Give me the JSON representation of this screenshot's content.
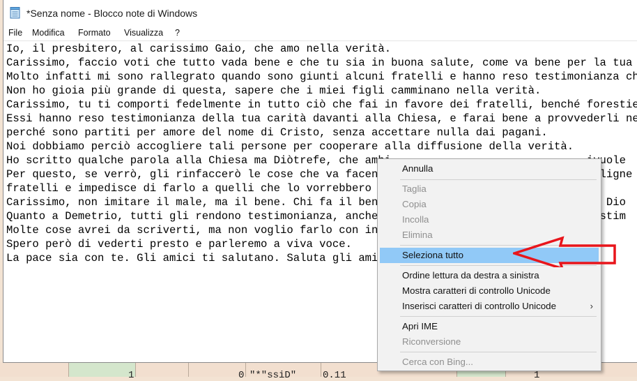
{
  "window": {
    "title": "*Senza nome - Blocco note di Windows"
  },
  "menu": [
    "File",
    "Modifica",
    "Formato",
    "Visualizza",
    "?"
  ],
  "editor_lines": [
    "Io, il presbitero, al carissimo Gaio, che amo nella verità.",
    "Carissimo, faccio voti che tutto vada bene e che tu sia in buona salute, come va bene per la tua anim",
    "Molto infatti mi sono rallegrato quando sono giunti alcuni fratelli e hanno reso testimonianza che tu",
    "Non ho gioia più grande di questa, sapere che i miei figli camminano nella verità.",
    "Carissimo, tu ti comporti fedelmente in tutto ciò che fai in favore dei fratelli, benché forestieri.",
    "Essi hanno reso testimonianza della tua carità davanti alla Chiesa, e farai bene a provvederli nel vi",
    "perché sono partiti per amore del nome di Cristo, senza accettare nulla dai pagani.",
    "Noi dobbiamo perciò accogliere tali persone per cooperare alla diffusione della verità.",
    "Ho scritto qualche parola alla Chiesa ma Diòtrefe, che ambi                              ivuole",
    "Per questo, se verrò, gli rinfaccerò le cose che va facendo                              maligne",
    "fratelli e impedisce di farlo a quelli che lo vorrebbero e",
    "Carissimo, non imitare il male, ma il bene. Chi fa il bene                               to Dio",
    "Quanto a Demetrio, tutti gli rendono testimonianza, anche la                             testim",
    "Molte cose avrei da scriverti, ma non voglio farlo con inchi",
    "Spero però di vederti presto e parleremo a viva voce.",
    "La pace sia con te. Gli amici ti salutano. Saluta gli amici"
  ],
  "context_menu": {
    "items": [
      {
        "label": "Annulla",
        "enabled": true
      },
      {
        "label": "Taglia",
        "enabled": false
      },
      {
        "label": "Copia",
        "enabled": false
      },
      {
        "label": "Incolla",
        "enabled": false
      },
      {
        "label": "Elimina",
        "enabled": false
      },
      {
        "label": "Seleziona tutto",
        "enabled": true,
        "highlighted": true
      },
      {
        "label": "Ordine lettura da destra a sinistra",
        "enabled": true
      },
      {
        "label": "Mostra caratteri di controllo Unicode",
        "enabled": true
      },
      {
        "label": "Inserisci caratteri di controllo Unicode",
        "enabled": true,
        "submenu": true
      },
      {
        "label": "Apri IME",
        "enabled": true
      },
      {
        "label": "Riconversione",
        "enabled": false
      },
      {
        "label": "Cerca con Bing...",
        "enabled": false
      }
    ],
    "submenu_arrow": "›"
  },
  "background_fragments": [
    "1",
    "0",
    "\"*\"ssiD\"",
    "0.11",
    "1"
  ],
  "colors": {
    "highlight": "#91c9f7",
    "annotation_arrow": "#e8151b",
    "disabled_text": "#8f8f8f"
  },
  "icons": {
    "app": "notepad-icon",
    "annotation": "red-arrow-annotation",
    "submenu": "chevron-right-icon"
  }
}
